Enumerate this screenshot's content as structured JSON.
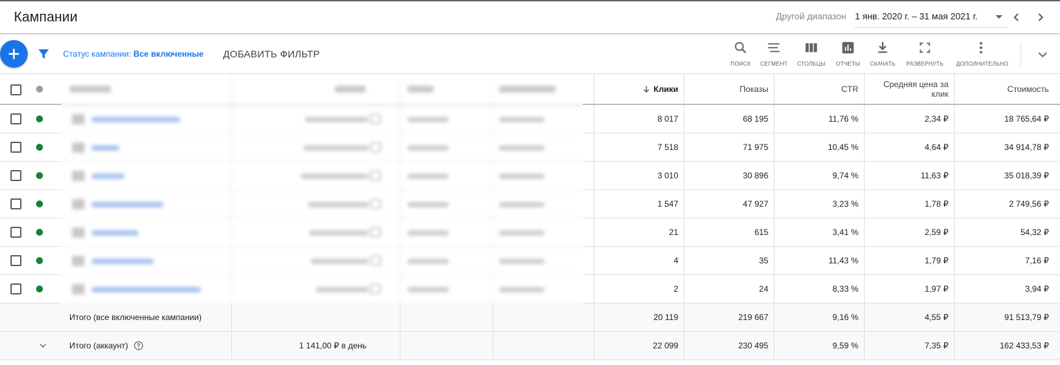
{
  "header": {
    "title": "Кампании",
    "range_label": "Другой диапазон",
    "range_value": "1 янв. 2020 г. – 31 мая 2021 г."
  },
  "toolbar": {
    "status_label": "Статус кампании:",
    "status_value": "Все включенные",
    "add_filter": "ДОБАВИТЬ ФИЛЬТР",
    "tools": {
      "search": "ПОИСК",
      "segment": "СЕГМЕНТ",
      "columns": "СТОЛБЦЫ",
      "reports": "ОТЧЕТЫ",
      "download": "СКАЧАТЬ",
      "expand": "РАЗВЕРНУТЬ",
      "more": "ДОПОЛНИТЕЛЬНО"
    }
  },
  "table": {
    "headers": {
      "clicks": "Клики",
      "impressions": "Показы",
      "ctr": "CTR",
      "avg_cpc": "Средняя цена за клик",
      "cost": "Стоимость"
    },
    "rows": [
      {
        "clicks": "8 017",
        "impressions": "68 195",
        "ctr": "11,76 %",
        "avg_cpc": "2,34 ₽",
        "cost": "18 765,64 ₽"
      },
      {
        "clicks": "7 518",
        "impressions": "71 975",
        "ctr": "10,45 %",
        "avg_cpc": "4,64 ₽",
        "cost": "34 914,78 ₽"
      },
      {
        "clicks": "3 010",
        "impressions": "30 896",
        "ctr": "9,74 %",
        "avg_cpc": "11,63 ₽",
        "cost": "35 018,39 ₽"
      },
      {
        "clicks": "1 547",
        "impressions": "47 927",
        "ctr": "3,23 %",
        "avg_cpc": "1,78 ₽",
        "cost": "2 749,56 ₽"
      },
      {
        "clicks": "21",
        "impressions": "615",
        "ctr": "3,41 %",
        "avg_cpc": "2,59 ₽",
        "cost": "54,32 ₽"
      },
      {
        "clicks": "4",
        "impressions": "35",
        "ctr": "11,43 %",
        "avg_cpc": "1,79 ₽",
        "cost": "7,16 ₽"
      },
      {
        "clicks": "2",
        "impressions": "24",
        "ctr": "8,33 %",
        "avg_cpc": "1,97 ₽",
        "cost": "3,94 ₽"
      }
    ],
    "totals": [
      {
        "label": "Итого (все включенные кампании)",
        "budget": "",
        "clicks": "20 119",
        "impressions": "219 667",
        "ctr": "9,16 %",
        "avg_cpc": "4,55 ₽",
        "cost": "91 513,79 ₽"
      },
      {
        "label": "Итого (аккаунт)",
        "budget": "1 141,00 ₽ в день",
        "clicks": "22 099",
        "impressions": "230 495",
        "ctr": "9,59 %",
        "avg_cpc": "7,35 ₽",
        "cost": "162 433,53 ₽"
      }
    ]
  },
  "colors": {
    "accent": "#1a73e8",
    "status_enabled": "#188038",
    "status_header": "#9e9e9e"
  },
  "icons": [
    "add-icon",
    "filter-icon",
    "search-icon",
    "segment-icon",
    "columns-icon",
    "reports-icon",
    "download-icon",
    "fullscreen-icon",
    "more-vert-icon",
    "chevron-left-icon",
    "chevron-right-icon",
    "chevron-down-icon",
    "arrow-down-icon",
    "help-icon"
  ]
}
